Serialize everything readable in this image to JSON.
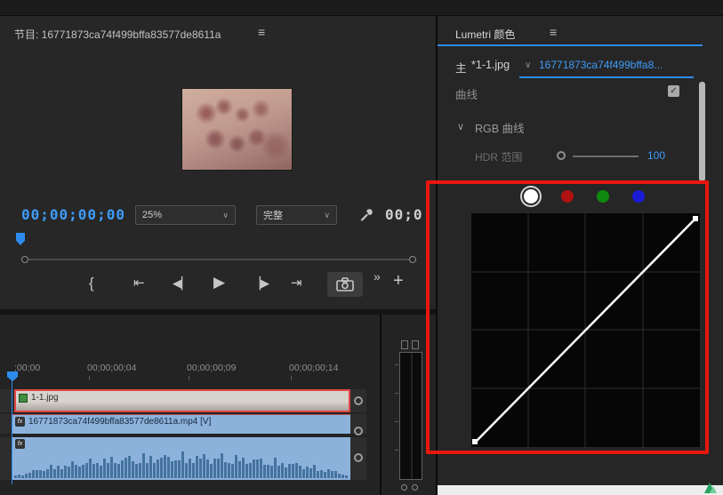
{
  "colors": {
    "accent_blue": "#2d8ceb",
    "link_blue": "#3f9bfa",
    "annotation_red": "#e8170e",
    "clip_blue": "#8cb2dc",
    "selection_red": "#e04545",
    "channel_red": "#b01212",
    "channel_green": "#0f8a0f",
    "channel_blue": "#1b1bd6"
  },
  "icons": {
    "panel_menu": "≡",
    "chevron_down": "∨",
    "marker": "{",
    "go_to_in": "⇤",
    "step_back": "◀▏",
    "play": "▶",
    "step_forward": "▕▶",
    "go_to_out": "⇥",
    "more": "»",
    "plus": "+",
    "check": "✓"
  },
  "program_monitor": {
    "tab_title": "节目: 16771873ca74f499bffa83577de8611a",
    "timecode": "00;00;00;00",
    "zoom_value": "25%",
    "quality_value": "完整",
    "duration_clipped": "00;0"
  },
  "lumetri": {
    "tab_title": "Lumetri 颜色",
    "master_label": "主",
    "clip_name": "*1-1.jpg",
    "clip_link": "16771873ca74f499bffa8...",
    "curves_label": "曲线",
    "rgb_curves_label": "RGB 曲线",
    "hdr_label": "HDR 范围",
    "hdr_value": "100",
    "channels": [
      "white",
      "red",
      "green",
      "blue"
    ]
  },
  "timeline": {
    "ruler_ticks": [
      ";00;00",
      "00;00;00;04",
      "00;00;00;09",
      "00;00;00;14"
    ],
    "clip_image_label": "1-1.jpg",
    "clip_video_label": "16771873ca74f499bffa83577de8611a.mp4 [V]",
    "fx_badge": "fx"
  }
}
